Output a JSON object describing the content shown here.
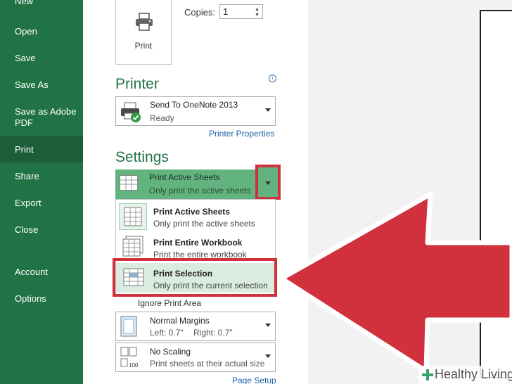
{
  "sidebar": {
    "items": [
      {
        "label": "New"
      },
      {
        "label": "Open"
      },
      {
        "label": "Save"
      },
      {
        "label": "Save As"
      },
      {
        "label": "Save as Adobe PDF"
      },
      {
        "label": "Print"
      },
      {
        "label": "Share"
      },
      {
        "label": "Export"
      },
      {
        "label": "Close"
      },
      {
        "label": "Account"
      },
      {
        "label": "Options"
      }
    ],
    "active": "Print"
  },
  "print": {
    "button_label": "Print",
    "copies_label": "Copies:",
    "copies_value": "1"
  },
  "printer": {
    "title": "Printer",
    "name": "Send To OneNote 2013",
    "status": "Ready",
    "properties_link": "Printer Properties"
  },
  "settings": {
    "title": "Settings",
    "selected": {
      "title": "Print Active Sheets",
      "subtitle": "Only print the active sheets"
    },
    "menu": [
      {
        "title": "Print Active Sheets",
        "subtitle": "Only print the active sheets"
      },
      {
        "title": "Print Entire Workbook",
        "subtitle": "Print the entire workbook"
      },
      {
        "title": "Print Selection",
        "subtitle": "Only print the current selection"
      }
    ],
    "ignore_print_area": "Ignore Print Area",
    "margins": {
      "title": "Normal Margins",
      "left": "Left:  0.7\"",
      "right": "Right:  0.7\""
    },
    "scaling": {
      "title": "No Scaling",
      "subtitle": "Print sheets at their actual size"
    },
    "page_setup_link": "Page Setup"
  },
  "watermark": {
    "text": "Healthy Living"
  },
  "colors": {
    "sidebar": "#217346",
    "accent_red": "#d0313d",
    "selection_green": "#62b37e"
  }
}
